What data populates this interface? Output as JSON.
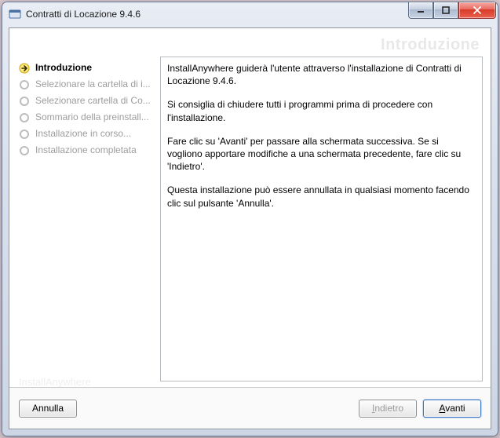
{
  "window": {
    "title": "Contratti di Locazione 9.4.6"
  },
  "banner": {
    "heading": "Introduzione",
    "watermark": "InstallAnywhere"
  },
  "steps": [
    {
      "label": "Introduzione",
      "active": true
    },
    {
      "label": "Selezionare la cartella di i...",
      "active": false
    },
    {
      "label": "Selezionare cartella di Co...",
      "active": false
    },
    {
      "label": "Sommario della preinstall...",
      "active": false
    },
    {
      "label": "Installazione in corso...",
      "active": false
    },
    {
      "label": "Installazione completata",
      "active": false
    }
  ],
  "content": {
    "p1": "InstallAnywhere guiderà l'utente attraverso l'installazione di Contratti di Locazione 9.4.6.",
    "p2": "Si consiglia di chiudere tutti i programmi prima di procedere con l'installazione.",
    "p3": "Fare clic su 'Avanti' per passare alla schermata successiva. Se si vogliono apportare modifiche a una schermata precedente, fare clic su 'Indietro'.",
    "p4": "Questa installazione può essere annullata in qualsiasi momento facendo clic sul pulsante 'Annulla'."
  },
  "footer": {
    "cancel": "Annulla",
    "back": "Indietro",
    "next": "Avanti",
    "back_enabled": false
  }
}
